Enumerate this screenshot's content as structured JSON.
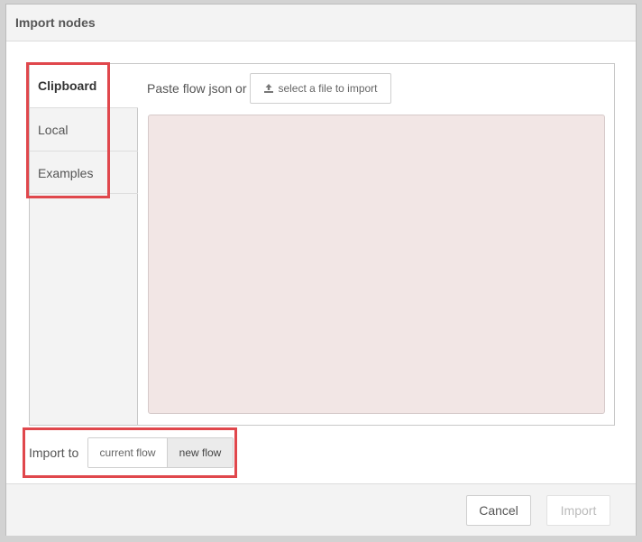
{
  "dialog": {
    "title": "Import nodes"
  },
  "tabs": [
    {
      "label": "Clipboard",
      "active": true
    },
    {
      "label": "Local",
      "active": false
    },
    {
      "label": "Examples",
      "active": false
    }
  ],
  "clipboard": {
    "paste_label": "Paste flow json or",
    "file_button_label": "select a file to import",
    "file_button_icon": "upload-icon",
    "textarea_value": ""
  },
  "import_to": {
    "label": "Import to",
    "options": [
      {
        "label": "current flow",
        "selected": false
      },
      {
        "label": "new flow",
        "selected": true
      }
    ]
  },
  "footer": {
    "cancel_label": "Cancel",
    "import_label": "Import"
  },
  "annotations": {
    "highlight_color": "#e0474c"
  },
  "colors": {
    "textarea_bg": "#f2e6e5",
    "selected_segment_bg": "#ebebeb"
  }
}
